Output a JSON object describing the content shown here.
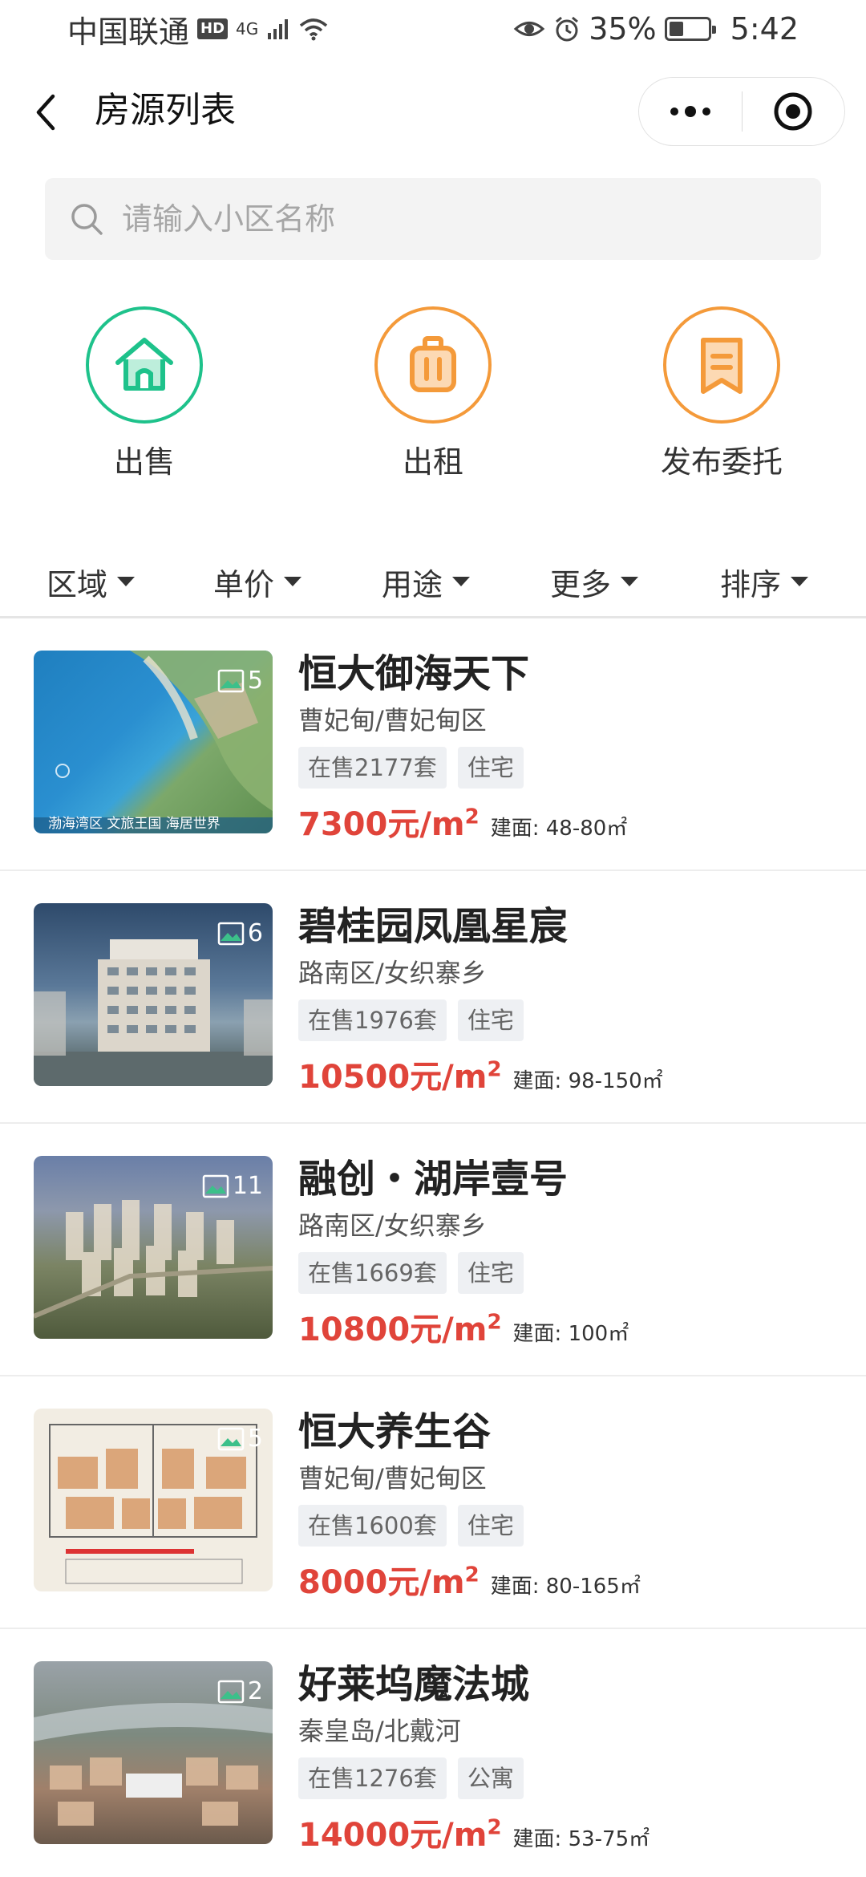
{
  "status_bar": {
    "carrier": "中国联通",
    "hd": "HD",
    "net": "4G",
    "battery": "35%",
    "time": "5:42"
  },
  "nav": {
    "title": "房源列表"
  },
  "search": {
    "placeholder": "请输入小区名称"
  },
  "categories": [
    {
      "label": "出售",
      "icon": "house-icon",
      "color": "#1ec28b"
    },
    {
      "label": "出租",
      "icon": "luggage-icon",
      "color": "#f49a3a"
    },
    {
      "label": "发布委托",
      "icon": "bookmark-icon",
      "color": "#f49a3a"
    }
  ],
  "filters": [
    "区域",
    "单价",
    "用途",
    "更多",
    "排序"
  ],
  "listings": [
    {
      "name": "恒大御海天下",
      "area": "曹妃甸/曹妃甸区",
      "on_sale": "在售2177套",
      "use": "住宅",
      "price": "7300元/m",
      "build": "建面: 48-80㎡",
      "photos": "5",
      "caption": "渤海湾区 文旅王国 海居世界"
    },
    {
      "name": "碧桂园凤凰星宸",
      "area": "路南区/女织寨乡",
      "on_sale": "在售1976套",
      "use": "住宅",
      "price": "10500元/m",
      "build": "建面: 98-150㎡",
      "photos": "6"
    },
    {
      "name": "融创・湖岸壹号",
      "area": "路南区/女织寨乡",
      "on_sale": "在售1669套",
      "use": "住宅",
      "price": "10800元/m",
      "build": "建面: 100㎡",
      "photos": "11"
    },
    {
      "name": "恒大养生谷",
      "area": "曹妃甸/曹妃甸区",
      "on_sale": "在售1600套",
      "use": "住宅",
      "price": "8000元/m",
      "build": "建面: 80-165㎡",
      "photos": "5"
    },
    {
      "name": "好莱坞魔法城",
      "area": "秦皇岛/北戴河",
      "on_sale": "在售1276套",
      "use": "公寓",
      "price": "14000元/m",
      "build": "建面: 53-75㎡",
      "photos": "2"
    }
  ],
  "colors": {
    "price": "#e0443a",
    "sale_green": "#1ec28b",
    "rent_orange": "#f49a3a"
  }
}
